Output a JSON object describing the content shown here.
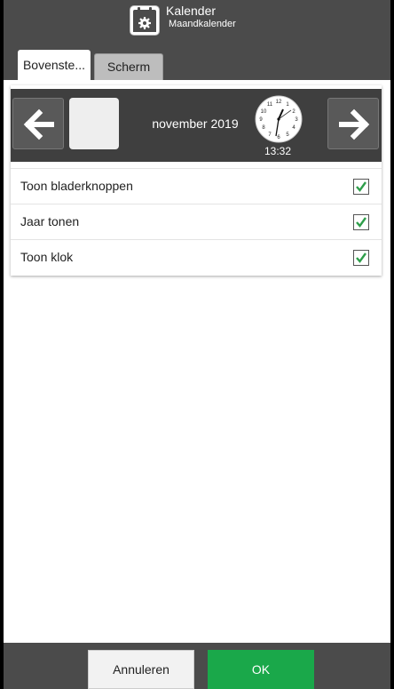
{
  "header": {
    "title": "Kalender",
    "subtitle": "Maandkalender",
    "icon": "calendar-gear-icon"
  },
  "tabs": [
    {
      "label": "Bovenste...",
      "active": true
    },
    {
      "label": "Scherm",
      "active": false
    }
  ],
  "preview": {
    "month_label": "november 2019",
    "clock_time": "13:32",
    "prev_icon": "arrow-left-icon",
    "next_icon": "arrow-right-icon"
  },
  "options": [
    {
      "label": "Toon bladerknoppen",
      "checked": true
    },
    {
      "label": "Jaar tonen",
      "checked": true
    },
    {
      "label": "Toon klok",
      "checked": true
    }
  ],
  "footer": {
    "cancel_label": "Annuleren",
    "ok_label": "OK"
  },
  "colors": {
    "ok_green": "#1aa84a",
    "check_green": "#2e9e4a",
    "chrome": "#4b4b4b"
  }
}
